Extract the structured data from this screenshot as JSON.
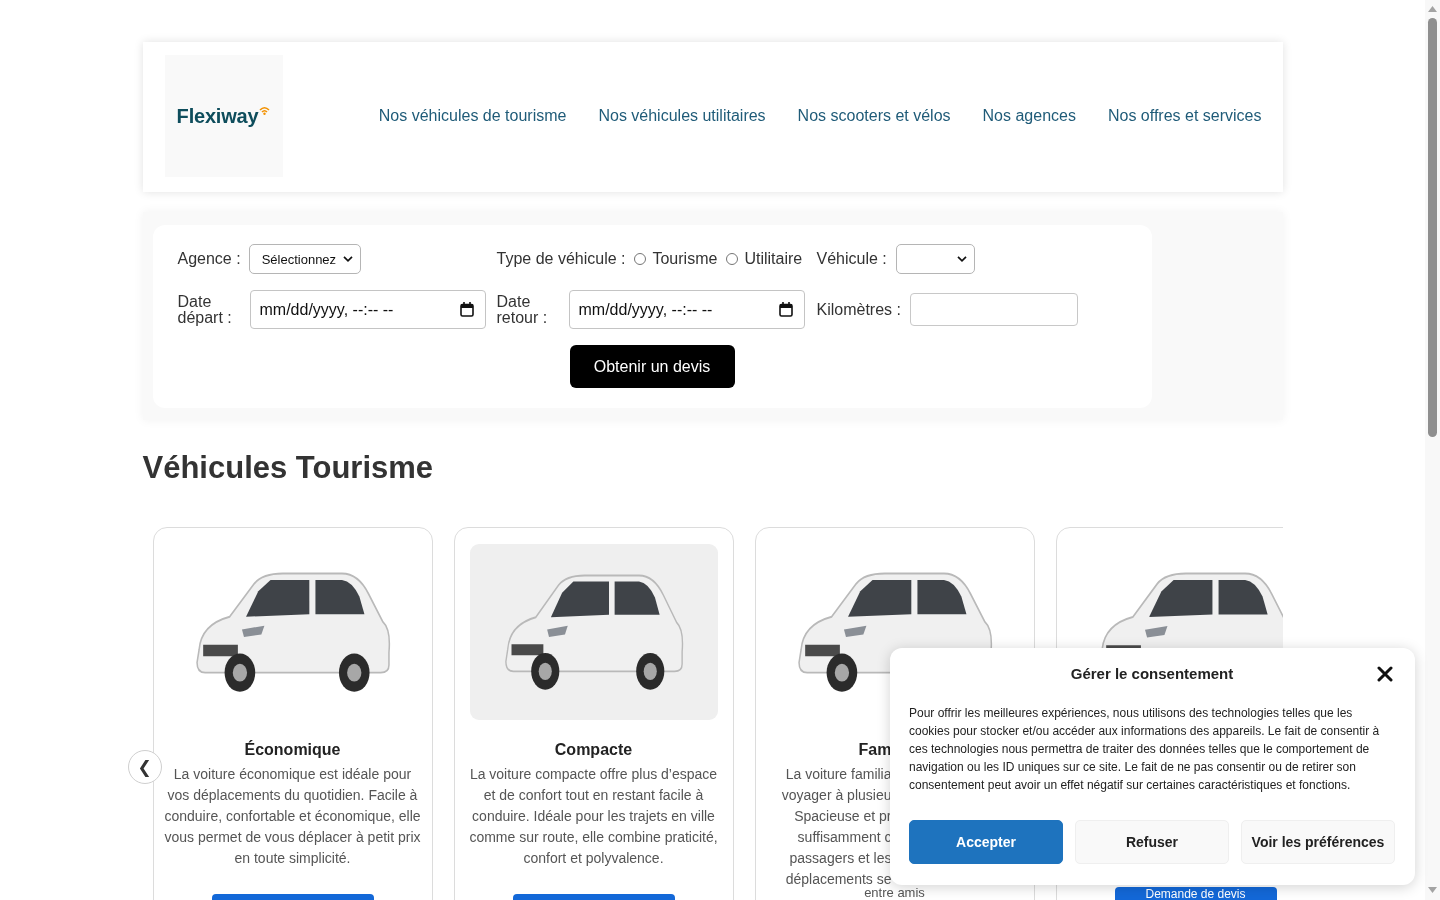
{
  "header": {
    "logo": "Flexiway",
    "nav": [
      {
        "label": "Nos véhicules de tourisme"
      },
      {
        "label": "Nos véhicules utilitaires"
      },
      {
        "label": "Nos scooters et vélos"
      },
      {
        "label": "Nos agences"
      },
      {
        "label": "Nos offres et services"
      }
    ]
  },
  "search_form": {
    "agency": {
      "label": "Agence :",
      "value": "Sélectionnez"
    },
    "vehicle_type": {
      "label": "Type de véhicule :",
      "options": [
        {
          "label": "Tourisme",
          "selected": false
        },
        {
          "label": "Utilitaire",
          "selected": false
        }
      ]
    },
    "vehicle": {
      "label": "Véhicule :"
    },
    "departure": {
      "label": "Date départ :",
      "placeholder": "mm/dd/yyyy, --:-- --"
    },
    "return": {
      "label": "Date retour :",
      "placeholder": "mm/dd/yyyy, --:-- --"
    },
    "kilometers": {
      "label": "Kilomètres :"
    },
    "submit": "Obtenir un devis"
  },
  "section_title": "Véhicules Tourisme",
  "carousel": {
    "previous": "❮",
    "cards": [
      {
        "kind": "full",
        "shaded": false,
        "title": "Économique",
        "description": "La voiture économique est idéale pour vos déplacements du quotidien. Facile à conduire, confortable et économique, elle vous permet de vous déplacer à petit prix en toute simplicité.",
        "button": true
      },
      {
        "kind": "full",
        "shaded": true,
        "title": "Compacte",
        "description": "La voiture compacte offre plus d’espace et de confort tout en restant facile à conduire. Idéale pour les trajets en ville comme sur route, elle combine praticité, confort et polyvalence.",
        "button": true
      },
      {
        "kind": "partial",
        "shaded": false,
        "title": "Fam",
        "lines": [
          "La voiture familia",
          "voyager à plusieu",
          "Spacieuse et pr",
          "suffisamment c",
          "passagers et les",
          "déplacements se"
        ],
        "last_line": "entre amis"
      },
      {
        "kind": "masked",
        "shaded": false,
        "button": true,
        "button_label": "Demande de devis"
      }
    ]
  },
  "consent": {
    "title": "Gérer le consentement",
    "text": "Pour offrir les meilleures expériences, nous utilisons des technologies telles que les cookies pour stocker et/ou accéder aux informations des appareils. Le fait de consentir à ces technologies nous permettra de traiter des données telles que le comportement de navigation ou les ID uniques sur ce site. Le fait de ne pas consentir ou de retirer son consentement peut avoir un effet négatif sur certaines caractéristiques et fonctions.",
    "buttons": [
      {
        "label": "Accepter",
        "kind": "primary"
      },
      {
        "label": "Refuser",
        "kind": "secondary"
      },
      {
        "label": "Voir les préférences",
        "kind": "secondary"
      }
    ]
  }
}
